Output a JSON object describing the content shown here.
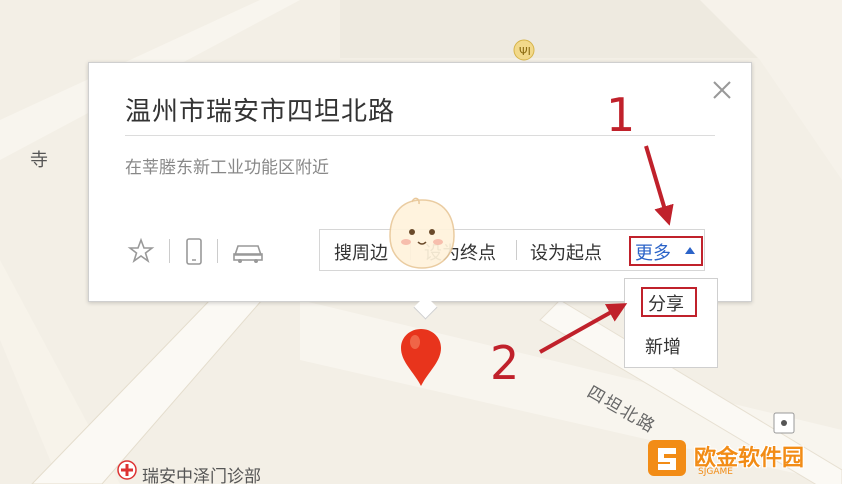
{
  "map": {
    "place_label_left": "寺",
    "clinic_label": "瑞安中泽门诊部",
    "road_label": "四坦北路"
  },
  "card": {
    "title": "温州市瑞安市四坦北路",
    "subtitle": "在莘塍东新工业功能区附近",
    "actions": {
      "nearby": "搜周边",
      "set_end": "设为终点",
      "set_start": "设为起点",
      "more": "更多"
    }
  },
  "dropdown": {
    "share": "分享",
    "add": "新增"
  },
  "annotations": {
    "step1": "1",
    "step2": "2"
  },
  "watermark": {
    "text": "欧金软件园",
    "sub": "SJGAME"
  },
  "colors": {
    "annotation_red": "#c0212b",
    "link_blue": "#2b63c8",
    "map_bg": "#f1ece2",
    "map_road": "#fbf9f3",
    "pin_red": "#e8341c",
    "watermark_orange": "#f28c16"
  }
}
